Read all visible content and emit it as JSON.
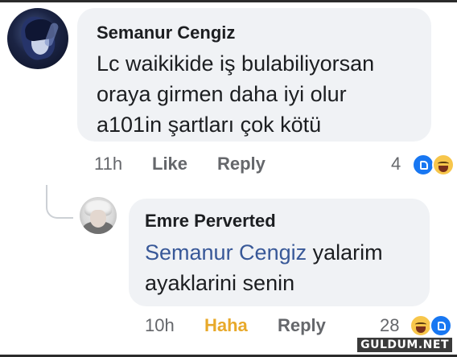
{
  "comments": [
    {
      "author": "Semanur Cengiz",
      "lines": [
        "Lc waikikide iş bulabiliyorsan",
        "oraya girmen daha iyi olur",
        "a101in şartları çok kötü"
      ],
      "time": "11h",
      "action_like": "Like",
      "action_reply": "Reply",
      "reaction_count": "4",
      "reaction_icons": [
        "like-icon",
        "haha-icon"
      ]
    },
    {
      "author": "Emre Perverted",
      "mention": "Semanur Cengiz",
      "line1_rest": " yalarim",
      "line2": "ayaklarini senin",
      "time": "10h",
      "action_haha": "Haha",
      "action_reply": "Reply",
      "reaction_count": "28",
      "reaction_icons": [
        "haha-icon",
        "like-icon"
      ]
    }
  ],
  "watermark": "GULDUM.NET",
  "colors": {
    "bubble": "#f0f2f5",
    "mention": "#385898",
    "haha_active": "#e8a92a",
    "like_blue": "#1877f2",
    "meta_gray": "#65676b"
  }
}
